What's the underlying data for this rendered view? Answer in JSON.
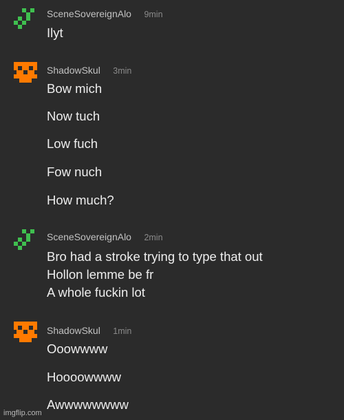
{
  "messages": [
    {
      "username": "SceneSovereignAlo",
      "time": "9min",
      "avatar_icon": "green-checker-pixel-avatar",
      "lines": [
        "Ilyt"
      ]
    },
    {
      "username": "ShadowSkul",
      "time": "3min",
      "avatar_icon": "orange-pixel-skull-avatar",
      "lines": [
        "Bow mich",
        "Now tuch",
        "Low fuch",
        "Fow nuch",
        "How much?"
      ]
    },
    {
      "username": "SceneSovereignAlo",
      "time": "2min",
      "avatar_icon": "green-checker-pixel-avatar",
      "lines": [
        "Bro had a stroke trying to type that out",
        "Hollon lemme be fr",
        "A whole fuckin lot"
      ]
    },
    {
      "username": "ShadowSkul",
      "time": "1min",
      "avatar_icon": "orange-pixel-skull-avatar",
      "lines": [
        "Ooowwww",
        "Hoooowwww",
        "Awwwwwwww"
      ]
    }
  ],
  "watermark": "imgflip.com",
  "colors": {
    "background": "#2b2b2b",
    "green_avatar": "#3fbf4f",
    "orange_avatar": "#ff7a00",
    "username": "#c2c2c2",
    "time": "#8a8a8a",
    "message_text": "#ededed"
  }
}
